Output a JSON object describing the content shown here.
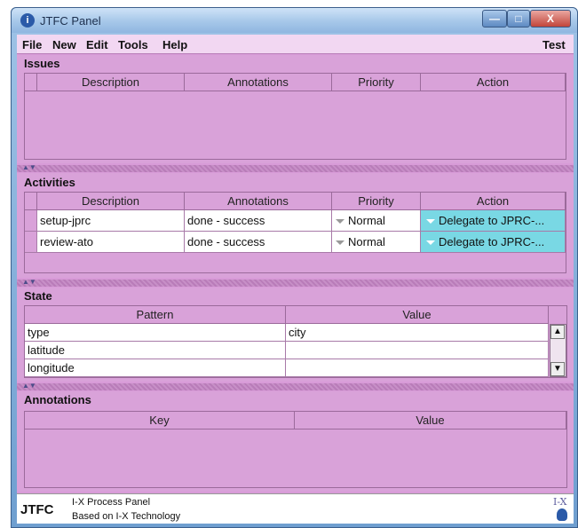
{
  "window": {
    "title": "JTFC Panel",
    "buttons": {
      "minimize": "—",
      "maximize": "□",
      "close": "X"
    }
  },
  "menubar": {
    "items": [
      "File",
      "New",
      "Edit",
      "Tools",
      "Help"
    ],
    "right_label": "Test"
  },
  "issues": {
    "title": "Issues",
    "columns": [
      "Description",
      "Annotations",
      "Priority",
      "Action"
    ],
    "rows": []
  },
  "activities": {
    "title": "Activities",
    "columns": [
      "Description",
      "Annotations",
      "Priority",
      "Action"
    ],
    "rows": [
      {
        "description": "setup-jprc",
        "annotations": "done - success",
        "priority": "Normal",
        "action": "Delegate to JPRC-..."
      },
      {
        "description": "review-ato",
        "annotations": "done - success",
        "priority": "Normal",
        "action": "Delegate to JPRC-..."
      }
    ]
  },
  "state": {
    "title": "State",
    "columns": [
      "Pattern",
      "Value"
    ],
    "rows": [
      {
        "pattern": "type",
        "value": "city"
      },
      {
        "pattern": "latitude",
        "value": ""
      },
      {
        "pattern": "longitude",
        "value": ""
      }
    ]
  },
  "annotations": {
    "title": "Annotations",
    "columns": [
      "Key",
      "Value"
    ]
  },
  "footer": {
    "logo": "JTFC",
    "line1": "I-X Process Panel",
    "line2": "Based on I-X Technology",
    "brand": "I-X"
  },
  "divider_glyph": "▲▼",
  "scroll_up_glyph": "▲",
  "scroll_down_glyph": "▼",
  "colors": {
    "panel": "#d9a2d9",
    "action_cell": "#79d8e4",
    "titlebar": "#a9c9ea"
  }
}
